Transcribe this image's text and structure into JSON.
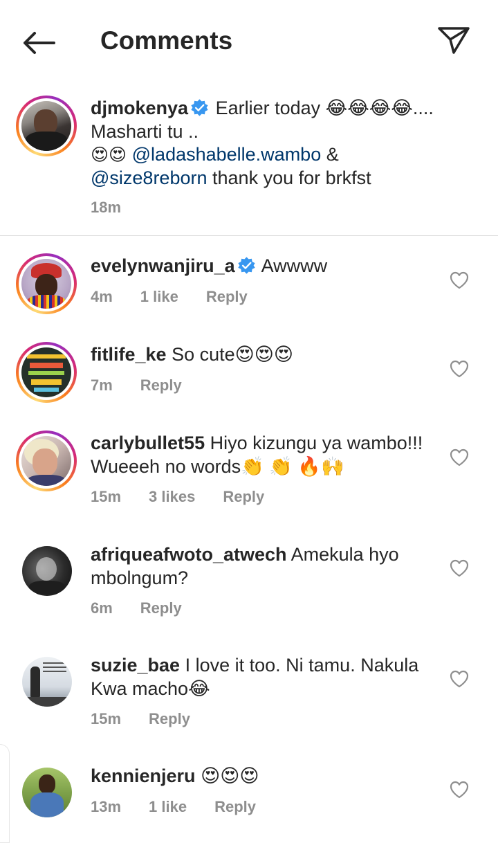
{
  "header": {
    "title": "Comments"
  },
  "icons": {
    "back": "arrow-left-icon",
    "share": "paper-plane-icon",
    "like": "heart-outline-icon",
    "verified": "verified-badge-icon"
  },
  "colors": {
    "text": "#262626",
    "muted": "#8e8e8e",
    "mention": "#00376b",
    "verified": "#3897f0"
  },
  "caption": {
    "username": "djmokenya",
    "line1": "Earlier today 😂😂😂😂....",
    "line2": "Masharti tu ..",
    "line3_emoji": "😍😍",
    "mention1": "@ladashabelle.wambo",
    "amp": "&",
    "mention2": "@size8reborn",
    "line4_rest": "thank you for brkfst",
    "time": "18m"
  },
  "comments": [
    {
      "username": "evelynwanjiru_a",
      "verified": true,
      "text": "Awwww",
      "time": "4m",
      "likes": "1 like",
      "reply": "Reply"
    },
    {
      "username": "fitlife_ke",
      "verified": false,
      "text": "So cute😍😍😍",
      "time": "7m",
      "likes": "",
      "reply": "Reply"
    },
    {
      "username": "carlybullet55",
      "verified": false,
      "text": "Hiyo kizungu ya wambo!!! Wueeeh no words👏 👏 🔥🙌",
      "time": "15m",
      "likes": "3 likes",
      "reply": "Reply"
    },
    {
      "username": "afriqueafwoto_atwech",
      "verified": false,
      "text": "Amekula hyo mbolngum?",
      "time": "6m",
      "likes": "",
      "reply": "Reply"
    },
    {
      "username": "suzie_bae",
      "verified": false,
      "text": "I love it too. Ni tamu. Nakula Kwa macho😂",
      "time": "15m",
      "likes": "",
      "reply": "Reply"
    },
    {
      "username": "kennienjeru",
      "verified": false,
      "text": "😍😍😍",
      "time": "13m",
      "likes": "1 like",
      "reply": "Reply"
    }
  ]
}
